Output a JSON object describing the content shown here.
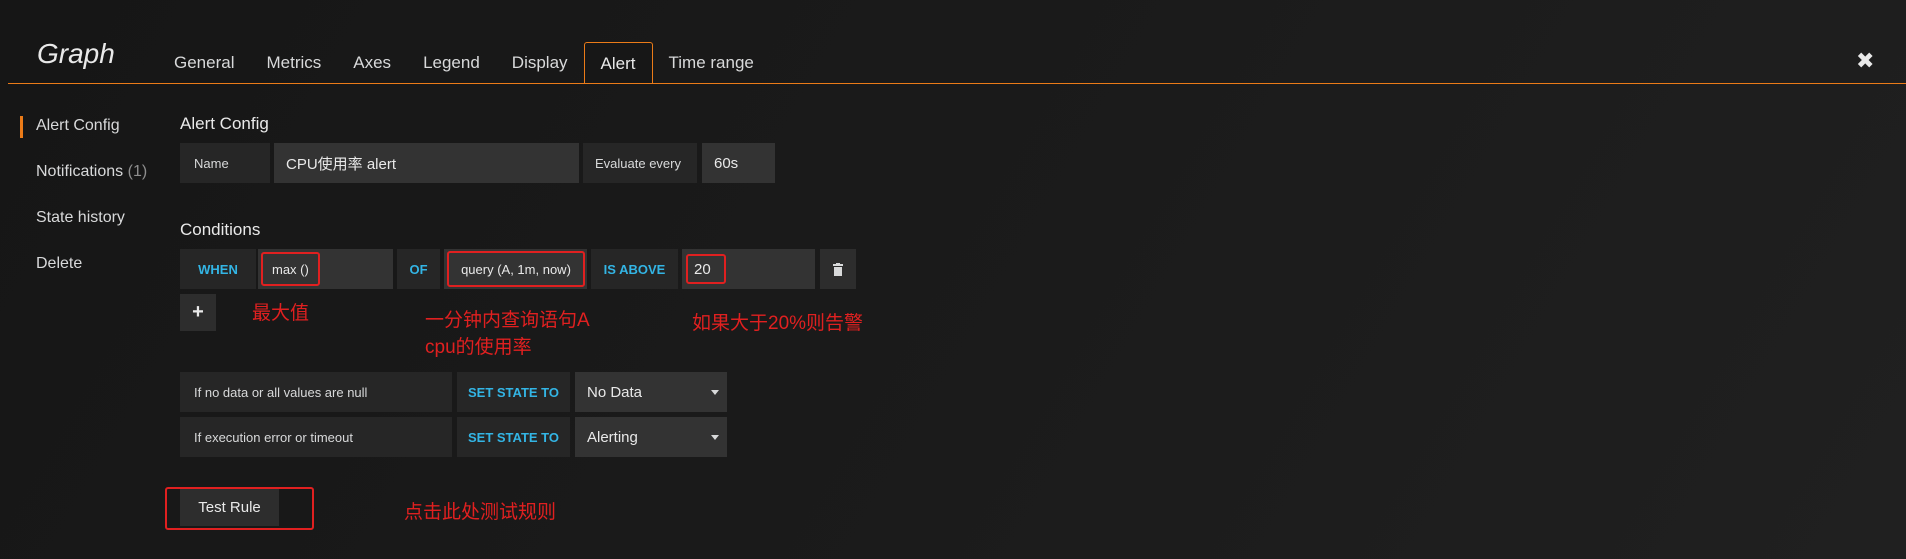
{
  "panel": {
    "title": "Graph",
    "tabs": [
      "General",
      "Metrics",
      "Axes",
      "Legend",
      "Display",
      "Alert",
      "Time range"
    ],
    "active_tab": "Alert",
    "close_icon": "close-icon"
  },
  "nav": {
    "items": [
      {
        "label": "Alert Config",
        "active": true
      },
      {
        "label": "Notifications",
        "count": "(1)"
      },
      {
        "label": "State history"
      },
      {
        "label": "Delete"
      }
    ]
  },
  "alert_config": {
    "section_title": "Alert Config",
    "name_label": "Name",
    "name_value": "CPU使用率 alert",
    "evaluate_label": "Evaluate every",
    "evaluate_value": "60s"
  },
  "conditions": {
    "section_title": "Conditions",
    "when": "WHEN",
    "reducer": "max ()",
    "of": "OF",
    "query": "query (A, 1m, now)",
    "evaluator": "IS ABOVE",
    "threshold": "20",
    "delete_icon": "trash-icon",
    "add_icon": "plus-icon"
  },
  "state_rules": [
    {
      "label": "If no data or all values are null",
      "action": "SET STATE TO",
      "value": "No Data"
    },
    {
      "label": "If execution error or timeout",
      "action": "SET STATE TO",
      "value": "Alerting"
    }
  ],
  "test_button": "Test Rule",
  "annotations": {
    "reducer_note": "最大值",
    "query_note_line1": "一分钟内查询语句A",
    "query_note_line2": "cpu的使用率",
    "threshold_note": "如果大于20%则告警",
    "test_note": "点击此处测试规则"
  },
  "colors": {
    "accent": "#eb7b18",
    "keyword": "#33b5e5",
    "annotation": "#e02020"
  }
}
